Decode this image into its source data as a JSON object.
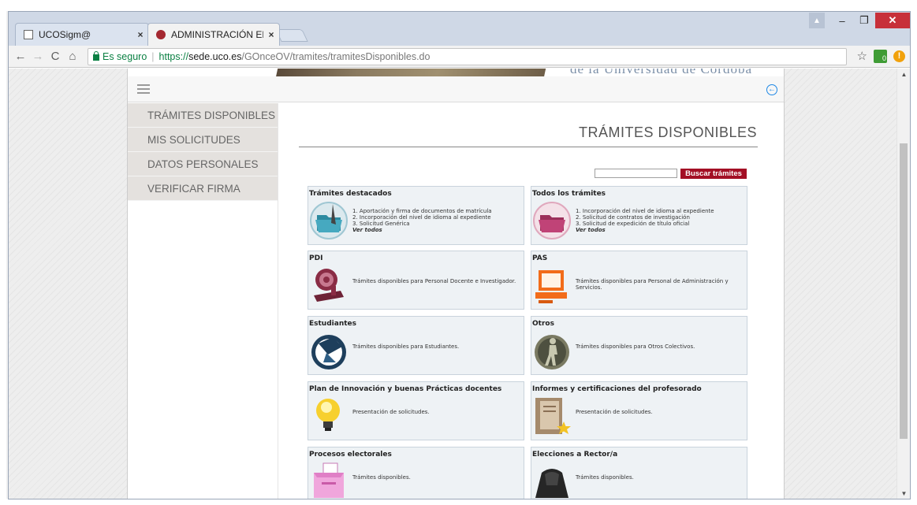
{
  "browser": {
    "tabs": [
      {
        "label": "UCOSigm@",
        "close": "×"
      },
      {
        "label": "ADMINISTRACIÓN ELECT",
        "close": "×"
      }
    ],
    "secure_label": "Es seguro",
    "url_scheme": "https://",
    "url_host": "sede.uco.es",
    "url_path": "/GOnceOV/tramites/tramitesDisponibles.do",
    "ext_badge": "0"
  },
  "site": {
    "banner_text": "de la Universidad de Córdoba",
    "nav": [
      {
        "label": "TRÁMITES DISPONIBLES"
      },
      {
        "label": "MIS SOLICITUDES"
      },
      {
        "label": "DATOS PERSONALES"
      },
      {
        "label": "VERIFICAR FIRMA"
      }
    ],
    "page_title": "TRÁMITES DISPONIBLES",
    "search_button": "Buscar trámites",
    "search_value": "",
    "cards": [
      {
        "title": "Trámites destacados",
        "items": [
          "1. Aportación y firma de documentos de matrícula",
          "2. Incorporación del nivel de idioma al expediente",
          "3. Solicitud Genérica"
        ],
        "more": "Ver todos",
        "icon": "teal-folder-icon"
      },
      {
        "title": "Todos los trámites",
        "items": [
          "1. Incorporación del nivel de idioma al expediente",
          "2. Solicitud de contratos de investigación",
          "3. Solicitud de expedición de título oficial"
        ],
        "more": "Ver todos",
        "icon": "pink-folder-icon"
      },
      {
        "title": "PDI",
        "description": "Trámites disponibles para Personal Docente e Investigador.",
        "icon": "microscope-icon"
      },
      {
        "title": "PAS",
        "description": "Trámites disponibles para Personal de Administración y Servicios.",
        "icon": "computer-icon"
      },
      {
        "title": "Estudiantes",
        "description": "Trámites disponibles para Estudiantes.",
        "icon": "graduation-cap-icon"
      },
      {
        "title": "Otros",
        "description": "Trámites disponibles para Otros Colectivos.",
        "icon": "person-walking-icon"
      },
      {
        "title": "Plan de Innovación y buenas Prácticas docentes",
        "description": "Presentación de solicitudes.",
        "icon": "lightbulb-icon"
      },
      {
        "title": "Informes y certificaciones del profesorado",
        "description": "Presentación de solicitudes.",
        "icon": "certificate-book-icon"
      },
      {
        "title": "Procesos electorales",
        "description": "Trámites disponibles.",
        "icon": "ballot-box-icon"
      },
      {
        "title": "Elecciones a Rector/a",
        "description": "Trámites disponibles.",
        "icon": "academic-robe-icon"
      }
    ]
  },
  "colors": {
    "accent": "#a30f25",
    "nav_bg": "#e4e1de",
    "card_bg": "#eef2f5"
  }
}
